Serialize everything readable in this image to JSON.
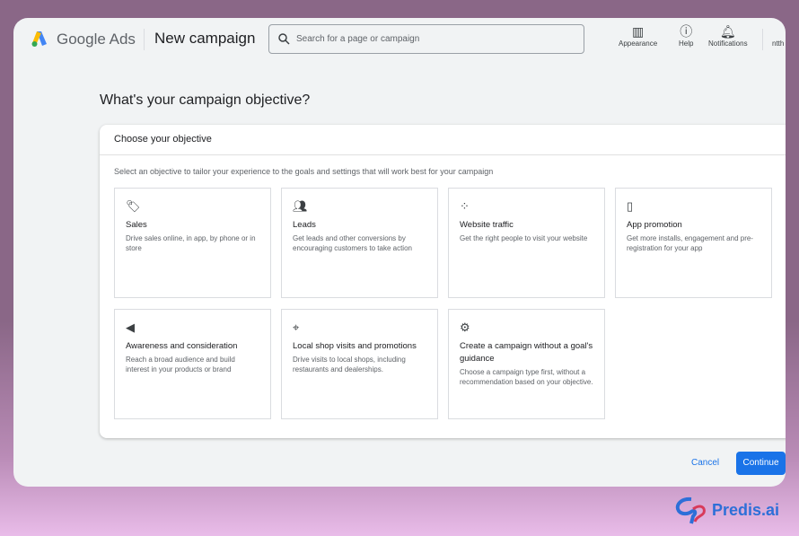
{
  "header": {
    "brand": "Google Ads",
    "page_title": "New campaign",
    "search_placeholder": "Search for a page or campaign",
    "appearance": "Appearance",
    "help": "Help",
    "notifications": "Notifications",
    "user": "ntth"
  },
  "main": {
    "heading": "What's your campaign objective?",
    "panel_title": "Choose your objective",
    "subtitle": "Select an objective to tailor your experience to the goals and settings that will work best for your campaign",
    "objectives": [
      {
        "icon": "tag-icon",
        "title": "Sales",
        "desc": "Drive sales online, in app, by phone or in store"
      },
      {
        "icon": "people-icon",
        "title": "Leads",
        "desc": "Get leads and other conversions by encouraging customers to take action"
      },
      {
        "icon": "cursor-click-icon",
        "title": "Website traffic",
        "desc": "Get the right people to visit your website"
      },
      {
        "icon": "phone-download-icon",
        "title": "App promotion",
        "desc": "Get more installs, engagement and pre-registration for your app"
      },
      {
        "icon": "megaphone-icon",
        "title": "Awareness and consideration",
        "desc": "Reach a broad audience and build interest in your products or brand"
      },
      {
        "icon": "location-pin-icon",
        "title": "Local shop visits and promotions",
        "desc": "Drive visits to local shops, including restaurants and dealerships."
      },
      {
        "icon": "gear-icon",
        "title": "Create a campaign without a goal's guidance",
        "desc": "Choose a campaign type first, without a recommendation based on your objective."
      }
    ]
  },
  "footer": {
    "cancel": "Cancel",
    "continue": "Continue"
  },
  "watermark": "Predis.ai",
  "colors": {
    "accent": "#1a73e8",
    "background": "#f1f3f4"
  }
}
